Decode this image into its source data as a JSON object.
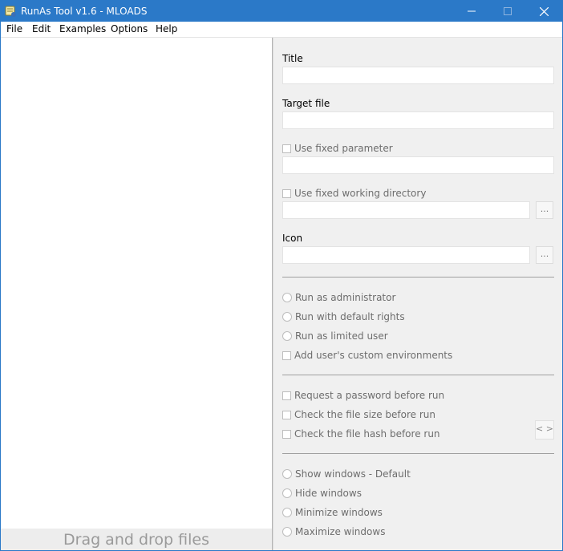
{
  "window": {
    "title": "RunAs Tool v1.6 - MLOADS"
  },
  "menu": [
    "File",
    "Edit",
    "Examples",
    "Options",
    "Help"
  ],
  "left_pane": {
    "drop_text": "Drag and drop files"
  },
  "form": {
    "title_label": "Title",
    "title_value": "",
    "target_label": "Target file",
    "target_value": "",
    "fixed_param_label": "Use fixed parameter",
    "fixed_param_value": "",
    "fixed_dir_label": "Use fixed working directory",
    "fixed_dir_value": "",
    "browse_label": "...",
    "icon_label": "Icon",
    "icon_value": ""
  },
  "run_modes": [
    "Run as administrator",
    "Run with default rights",
    "Run as limited user"
  ],
  "custom_env_label": "Add user's custom environments",
  "checks": [
    "Request a password before run",
    "Check the file size before run",
    "Check the file hash before run"
  ],
  "nav_label": "< >",
  "window_modes": [
    "Show windows - Default",
    "Hide windows",
    "Minimize windows",
    "Maximize windows"
  ],
  "icons": {
    "app": "scroll-key-icon",
    "minimize": "minimize-icon",
    "maximize": "maximize-icon",
    "close": "close-icon"
  },
  "colors": {
    "titlebar": "#2b79c8",
    "disabled_text": "#6d6d6d"
  }
}
